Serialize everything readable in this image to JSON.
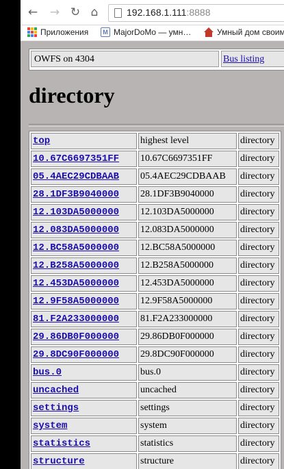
{
  "browser": {
    "url_host": "192.168.1.111",
    "url_port": ":8888",
    "bookmarks": [
      {
        "label": "Приложения",
        "icon": "apps-icon"
      },
      {
        "label": "MajorDoMo — умн…",
        "icon": "majordomo-icon"
      },
      {
        "label": "Умный дом своим…",
        "icon": "home-icon"
      }
    ]
  },
  "page": {
    "owfs_title": "OWFS on 4304",
    "bus_listing": "Bus listing",
    "heading": "directory"
  },
  "directory": {
    "rows": [
      {
        "name": "top",
        "desc": "highest level",
        "type": "directory"
      },
      {
        "name": "10.67C6697351FF",
        "desc": "10.67C6697351FF",
        "type": "directory"
      },
      {
        "name": "05.4AEC29CDBAAB",
        "desc": "05.4AEC29CDBAAB",
        "type": "directory"
      },
      {
        "name": "28.1DF3B9040000",
        "desc": "28.1DF3B9040000",
        "type": "directory"
      },
      {
        "name": "12.103DA5000000",
        "desc": "12.103DA5000000",
        "type": "directory"
      },
      {
        "name": "12.083DA5000000",
        "desc": "12.083DA5000000",
        "type": "directory"
      },
      {
        "name": "12.BC58A5000000",
        "desc": "12.BC58A5000000",
        "type": "directory"
      },
      {
        "name": "12.B258A5000000",
        "desc": "12.B258A5000000",
        "type": "directory"
      },
      {
        "name": "12.453DA5000000",
        "desc": "12.453DA5000000",
        "type": "directory"
      },
      {
        "name": "12.9F58A5000000",
        "desc": "12.9F58A5000000",
        "type": "directory"
      },
      {
        "name": "81.F2A233000000",
        "desc": "81.F2A233000000",
        "type": "directory"
      },
      {
        "name": "29.86DB0F000000",
        "desc": "29.86DB0F000000",
        "type": "directory"
      },
      {
        "name": "29.8DC90F000000",
        "desc": "29.8DC90F000000",
        "type": "directory"
      },
      {
        "name": "bus.0",
        "desc": "bus.0",
        "type": "directory"
      },
      {
        "name": "uncached",
        "desc": "uncached",
        "type": "directory"
      },
      {
        "name": "settings",
        "desc": "settings",
        "type": "directory"
      },
      {
        "name": "system",
        "desc": "system",
        "type": "directory"
      },
      {
        "name": "statistics",
        "desc": "statistics",
        "type": "directory"
      },
      {
        "name": "structure",
        "desc": "structure",
        "type": "directory"
      }
    ]
  },
  "colors": {
    "link": "#1a0dab",
    "page_background": "#b8b4b4",
    "cell_background": "#e6e6e6"
  }
}
